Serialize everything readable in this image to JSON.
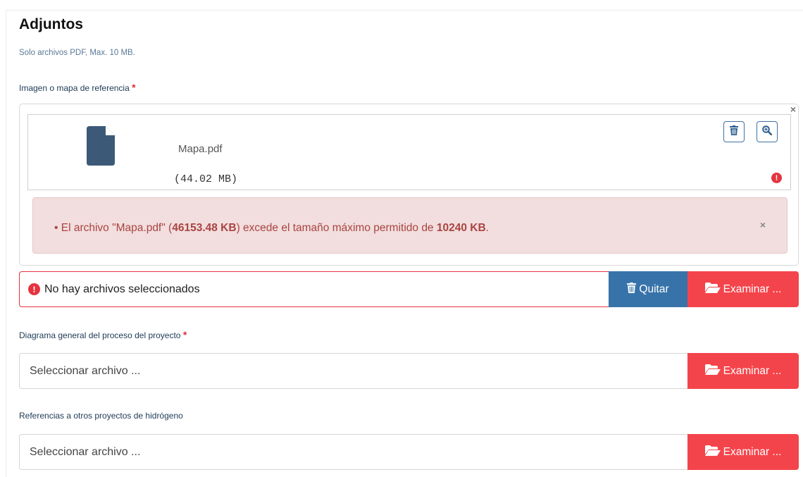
{
  "section": {
    "title": "Adjuntos",
    "hint": "Solo archivos PDF, Max. 10 MB."
  },
  "field1": {
    "label": "Imagen o mapa de referencia",
    "required_mark": "*",
    "file_name": "Mapa.pdf",
    "file_size": "(44.02 MB)",
    "close_glyph": "×",
    "error_glyph": "!",
    "alert": {
      "bullet": "•",
      "text_1": "El archivo \"Mapa.pdf\" (",
      "size_bold": "46153.48 KB",
      "text_2": ") excede el tamaño máximo permitido de ",
      "max_bold": "10240 KB",
      "text_3": ".",
      "close_glyph": "×"
    },
    "input_text": "No hay archivos seleccionados",
    "remove_label": "Quitar",
    "browse_label": "Examinar ..."
  },
  "field2": {
    "label": "Diagrama general del proceso del proyecto",
    "required_mark": "*",
    "placeholder": "Seleccionar archivo ...",
    "browse_label": "Examinar ..."
  },
  "field3": {
    "label": "Referencias a otros proyectos de hidrógeno",
    "placeholder": "Seleccionar archivo ...",
    "browse_label": "Examinar ..."
  },
  "icons": {
    "file": "file-icon",
    "trash": "trash-icon",
    "zoom": "zoom-in-icon",
    "folder": "folder-open-icon",
    "error": "exclamation-circle-icon"
  },
  "colors": {
    "primary": "#3773a9",
    "danger": "#f4444b",
    "alert_bg": "#f2dede",
    "alert_text": "#a94442",
    "file_icon": "#3c5a78"
  }
}
